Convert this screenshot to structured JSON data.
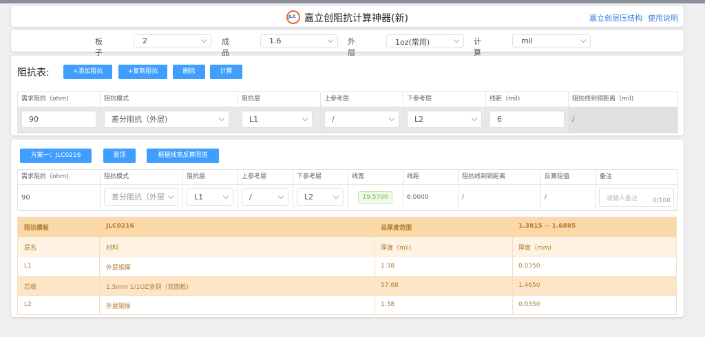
{
  "header": {
    "logo_text": "JLC",
    "title": "嘉立创阻抗计算神器(新)",
    "links": [
      "嘉立创层压结构",
      "使用说明"
    ]
  },
  "params": [
    {
      "label": "板子层数",
      "value": "2"
    },
    {
      "label": "成品板厚",
      "value": "1.6"
    },
    {
      "label": "外层铜厚",
      "value": "1oz(常用)"
    },
    {
      "label": "计算单位",
      "value": "mil"
    }
  ],
  "impedance": {
    "label": "阻抗表:",
    "buttons": [
      "+添加阻抗",
      "+复制阻抗",
      "删除",
      "计算"
    ],
    "columns": [
      "需求阻抗（ohm)",
      "阻抗模式",
      "阻抗层",
      "上参考层",
      "下参考层",
      "线距（mil)",
      "阻抗线到铜距离（mil)"
    ],
    "row": {
      "required": "90",
      "mode": "差分阻抗（外层)",
      "layer": "L1",
      "upper_ref": "/",
      "lower_ref": "L2",
      "spacing": "6",
      "copper_dist": "/"
    }
  },
  "solution": {
    "buttons": [
      "方案一：JLC0216",
      "置顶",
      "根据线宽反算阻值"
    ],
    "columns": [
      "需求阻抗（ohm)",
      "阻抗模式",
      "阻抗层",
      "上参考层",
      "下参考层",
      "线宽",
      "线距",
      "阻抗线到铜距离",
      "反算阻值",
      "备注"
    ],
    "row": {
      "required": "90",
      "mode": "差分阻抗（外层",
      "layer": "L1",
      "upper_ref": "/",
      "lower_ref": "L2",
      "width": "19.5700",
      "spacing": "6.0000",
      "copper_dist": "/",
      "back_calc": "/",
      "note_placeholder": "请输入备注",
      "note_count": "0/100"
    }
  },
  "stackup": {
    "template_label": "阻抗模板",
    "template_value": "JLC0216",
    "range_label": "总厚度范围",
    "range_value": "1.3815 ~ 1.6885",
    "columns": [
      "层名",
      "材料",
      "厚度（mil)",
      "厚度（mm)"
    ],
    "rows": [
      {
        "layer": "L1",
        "material": "外层铜厚",
        "mil": "1.38",
        "mm": "0.0350"
      },
      {
        "layer": "芯板",
        "material": "1.5mm 1/1OZ含铜（双面板)",
        "mil": "57.68",
        "mm": "1.4650"
      },
      {
        "layer": "L2",
        "material": "外层铜厚",
        "mil": "1.38",
        "mm": "0.0350"
      }
    ]
  },
  "colors": {
    "accent": "#409eff",
    "link": "#2f7de1",
    "stack_header": "#fad8a8",
    "stack_core": "#fde6c8",
    "stack_text": "#b07c30"
  }
}
